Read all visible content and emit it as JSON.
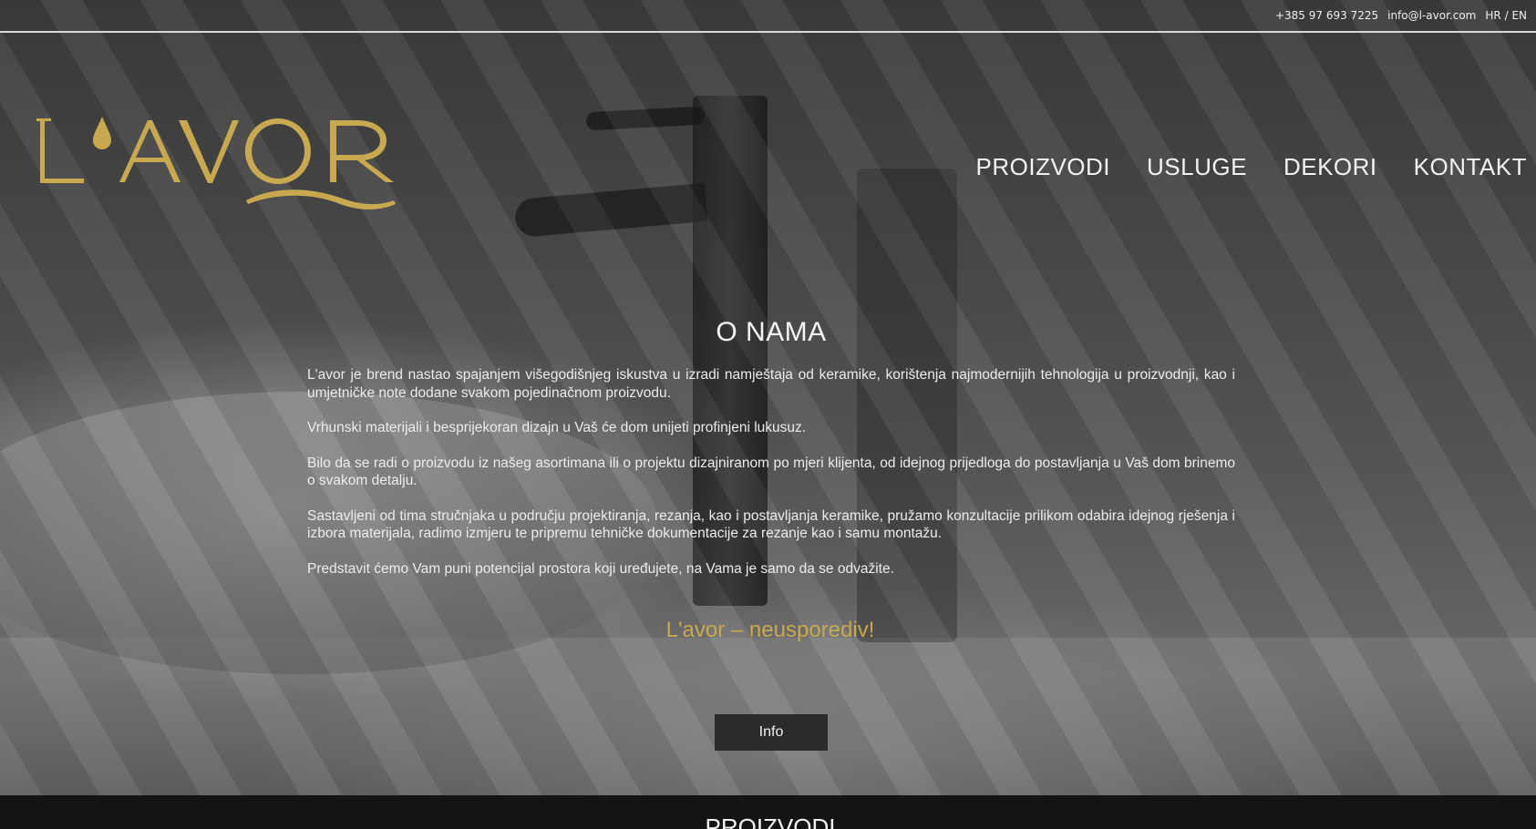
{
  "topbar": {
    "phone": "+385 97 693 7225",
    "email": "info@l-avor.com",
    "lang_hr": "HR",
    "lang_sep": "/",
    "lang_en": "EN"
  },
  "brand": {
    "logo_text": "L'AVOR",
    "logo_color": "#c9a94f"
  },
  "nav": {
    "items": [
      {
        "label": "PROIZVODI"
      },
      {
        "label": "USLUGE"
      },
      {
        "label": "DEKORI"
      },
      {
        "label": "KONTAKT"
      }
    ]
  },
  "about": {
    "title": "O NAMA",
    "paragraphs": [
      "L'avor je brend nastao spajanjem višegodišnjeg iskustva u izradi namještaja od keramike, korištenja najmodernijih tehnologija u proizvodnji, kao i umjetničke note dodane svakom pojedinačnom proizvodu.",
      "Vrhunski materijali i besprijekoran dizajn u Vaš će dom unijeti profinjeni lukusuz.",
      "Bilo da se radi o proizvodu iz našeg asortimana ili o projektu dizajniranom po mjeri klijenta, od idejnog prijedloga do postavljanja u Vaš dom brinemo o svakom detalju.",
      "Sastavljeni od tima stručnjaka u području projektiranja, rezanja, kao i postavljanja keramike, pružamo konzultacije prilikom odabira idejnog rješenja i izbora materijala, radimo izmjeru te pripremu tehničke dokumentacije za rezanje kao i samu montažu.",
      "Predstavit ćemo Vam puni potencijal prostora koji uređujete, na Vama je samo da se odvažite."
    ],
    "tagline": "L'avor – neusporediv!",
    "info_button": "Info"
  },
  "next_section": {
    "title": "PROIZVODI"
  }
}
